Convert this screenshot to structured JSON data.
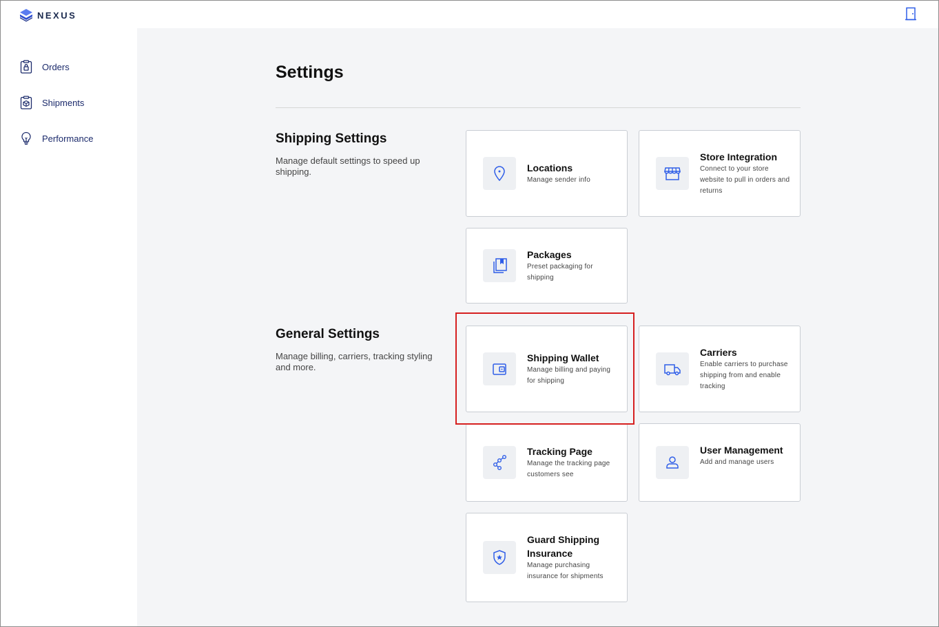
{
  "app": {
    "logo_text": "NEXUS"
  },
  "colors": {
    "accent": "#2f5ee8",
    "nav_text": "#1b2a6b",
    "highlight": "#d61f1f",
    "background": "#f4f5f7"
  },
  "header": {
    "exit_icon": "door-exit-icon"
  },
  "sidebar": {
    "items": [
      {
        "label": "Orders",
        "icon": "clipboard-lock-icon"
      },
      {
        "label": "Shipments",
        "icon": "clipboard-box-icon"
      },
      {
        "label": "Performance",
        "icon": "lightbulb-icon"
      }
    ]
  },
  "main": {
    "title": "Settings",
    "shipping": {
      "title": "Shipping Settings",
      "description": "Manage default settings to speed up shipping.",
      "cards": [
        {
          "title": "Locations",
          "description": "Manage sender info",
          "icon": "map-pin-icon"
        },
        {
          "title": "Store Integration",
          "description": "Connect to your store website to pull in orders and returns",
          "icon": "storefront-icon"
        },
        {
          "title": "Packages",
          "description": "Preset packaging for shipping",
          "icon": "packages-icon"
        }
      ]
    },
    "general": {
      "title": "General Settings",
      "description": "Manage billing, carriers, tracking styling and more.",
      "cards": [
        {
          "title": "Shipping Wallet",
          "description": "Manage billing and paying for shipping",
          "icon": "wallet-icon"
        },
        {
          "title": "Carriers",
          "description": "Enable carriers to purchase shipping from and enable tracking",
          "icon": "truck-icon"
        },
        {
          "title": "Tracking Page",
          "description": "Manage the tracking page customers see",
          "icon": "share-nodes-icon"
        },
        {
          "title": "User Management",
          "description": "Add and manage users",
          "icon": "user-icon"
        },
        {
          "title": "Guard Shipping Insurance",
          "description": "Manage purchasing insurance for shipments",
          "icon": "shield-star-icon"
        }
      ]
    }
  }
}
